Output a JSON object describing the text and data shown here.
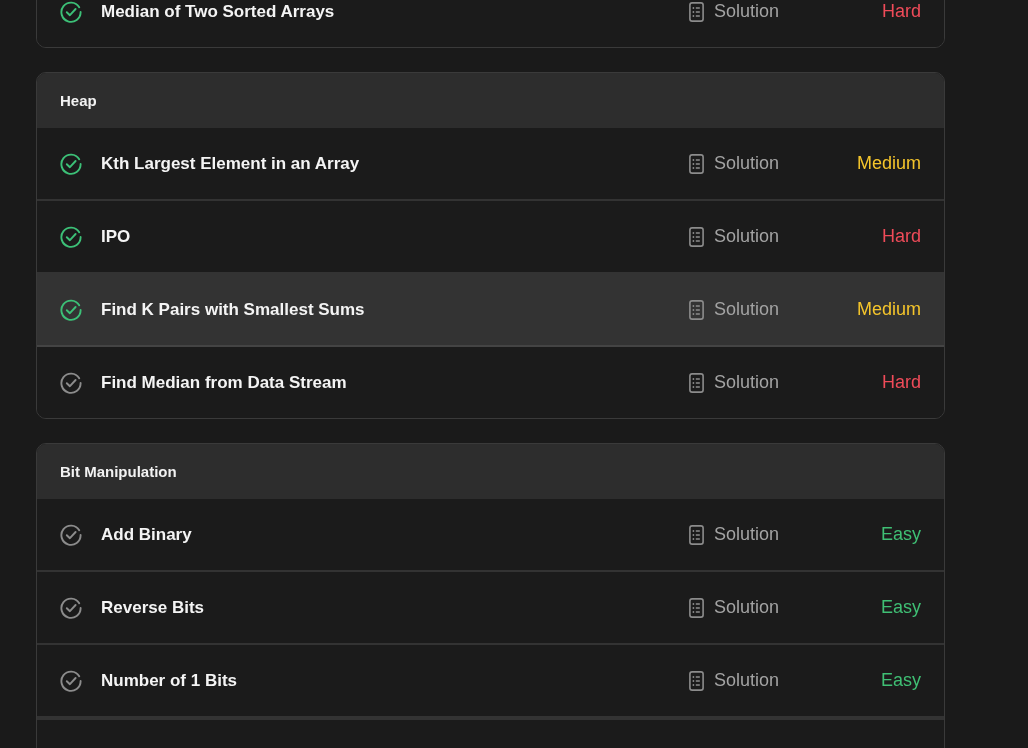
{
  "sections": [
    {
      "rows": [
        {
          "title": "Median of Two Sorted Arrays",
          "solved": true,
          "highlighted": false,
          "solution": "Solution",
          "difficulty": {
            "label": "Hard",
            "color": "#ef4b59"
          }
        }
      ]
    },
    {
      "title": "Heap",
      "rows": [
        {
          "title": "Kth Largest Element in an Array",
          "solved": true,
          "highlighted": false,
          "solution": "Solution",
          "difficulty": {
            "label": "Medium",
            "color": "#f5c52b"
          }
        },
        {
          "title": "IPO",
          "solved": true,
          "highlighted": false,
          "solution": "Solution",
          "difficulty": {
            "label": "Hard",
            "color": "#ef4b59"
          }
        },
        {
          "title": "Find K Pairs with Smallest Sums",
          "solved": true,
          "highlighted": true,
          "solution": "Solution",
          "difficulty": {
            "label": "Medium",
            "color": "#f5c52b"
          }
        },
        {
          "title": "Find Median from Data Stream",
          "solved": false,
          "highlighted": false,
          "solution": "Solution",
          "difficulty": {
            "label": "Hard",
            "color": "#ef4b59"
          }
        }
      ]
    },
    {
      "title": "Bit Manipulation",
      "rows": [
        {
          "title": "Add Binary",
          "solved": false,
          "highlighted": false,
          "solution": "Solution",
          "difficulty": {
            "label": "Easy",
            "color": "#3fbf74"
          }
        },
        {
          "title": "Reverse Bits",
          "solved": false,
          "highlighted": false,
          "solution": "Solution",
          "difficulty": {
            "label": "Easy",
            "color": "#3fbf74"
          }
        },
        {
          "title": "Number of 1 Bits",
          "solved": false,
          "highlighted": false,
          "solution": "Solution",
          "difficulty": {
            "label": "Easy",
            "color": "#3fbf74"
          }
        }
      ]
    }
  ]
}
